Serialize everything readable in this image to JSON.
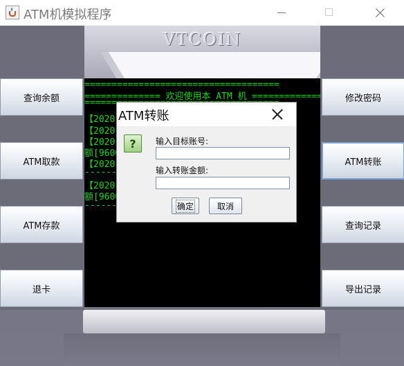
{
  "window": {
    "title": "ATM机模拟程序",
    "icon": "java-cup-icon"
  },
  "atm": {
    "brand": "VTCOIN",
    "left_buttons": [
      "查询余额",
      "ATM取款",
      "ATM存款",
      "退卡"
    ],
    "right_buttons": [
      "修改密码",
      "ATM转账",
      "查询记录",
      "导出记录"
    ]
  },
  "screen": {
    "lines": [
      "====================================",
      "============== 欢迎使用本 ATM 机 ==============",
      "====================================",
      "【2020-",
      "【2020-",
      "【2020-                         前余",
      "额[9600",
      "【2020-",
      "------------------------------------",
      "【2020-                         前余",
      "额[9600",
      "------------------------------------"
    ]
  },
  "dialog": {
    "title": "ATM转账",
    "icon": "question-icon",
    "icon_glyph": "?",
    "target_label": "输入目标账号:",
    "target_value": "",
    "amount_label": "输入转账金额:",
    "amount_value": "",
    "ok_label": "确定",
    "cancel_label": "取消"
  },
  "colors": {
    "screen_text": "#16d916",
    "screen_bg": "#000000",
    "atm_body": "#6f6f7e"
  }
}
